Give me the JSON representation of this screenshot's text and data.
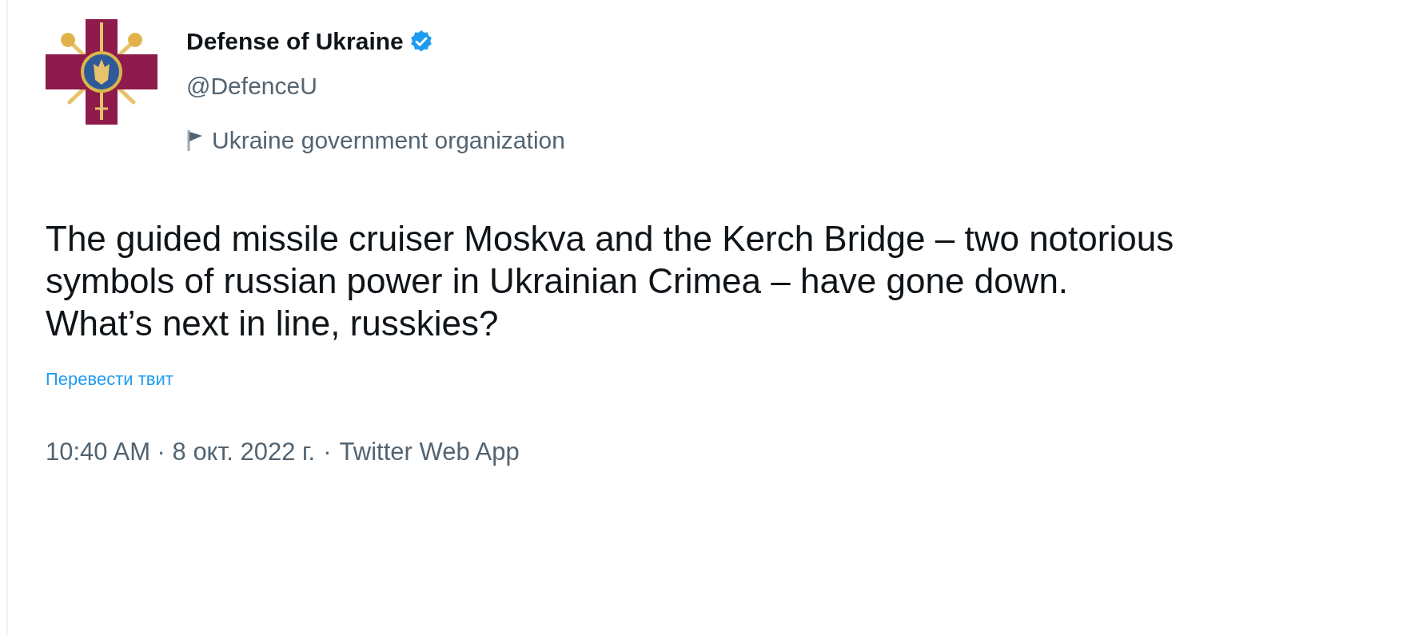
{
  "author": {
    "name": "Defense of Ukraine",
    "verified": true,
    "handle": "@DefenceU",
    "label": "Ukraine government organization"
  },
  "tweet": {
    "lines": [
      "The guided missile cruiser Moskva and the Kerch Bridge – two notorious symbols of russian power in Ukrainian Crimea – have gone down.",
      "What’s next in line, russkies?"
    ]
  },
  "translate_link": "Перевести твит",
  "meta": {
    "timestamp": "10:40 AM · 8 окт. 2022 г.",
    "separator": "·",
    "source": "Twitter Web App"
  }
}
